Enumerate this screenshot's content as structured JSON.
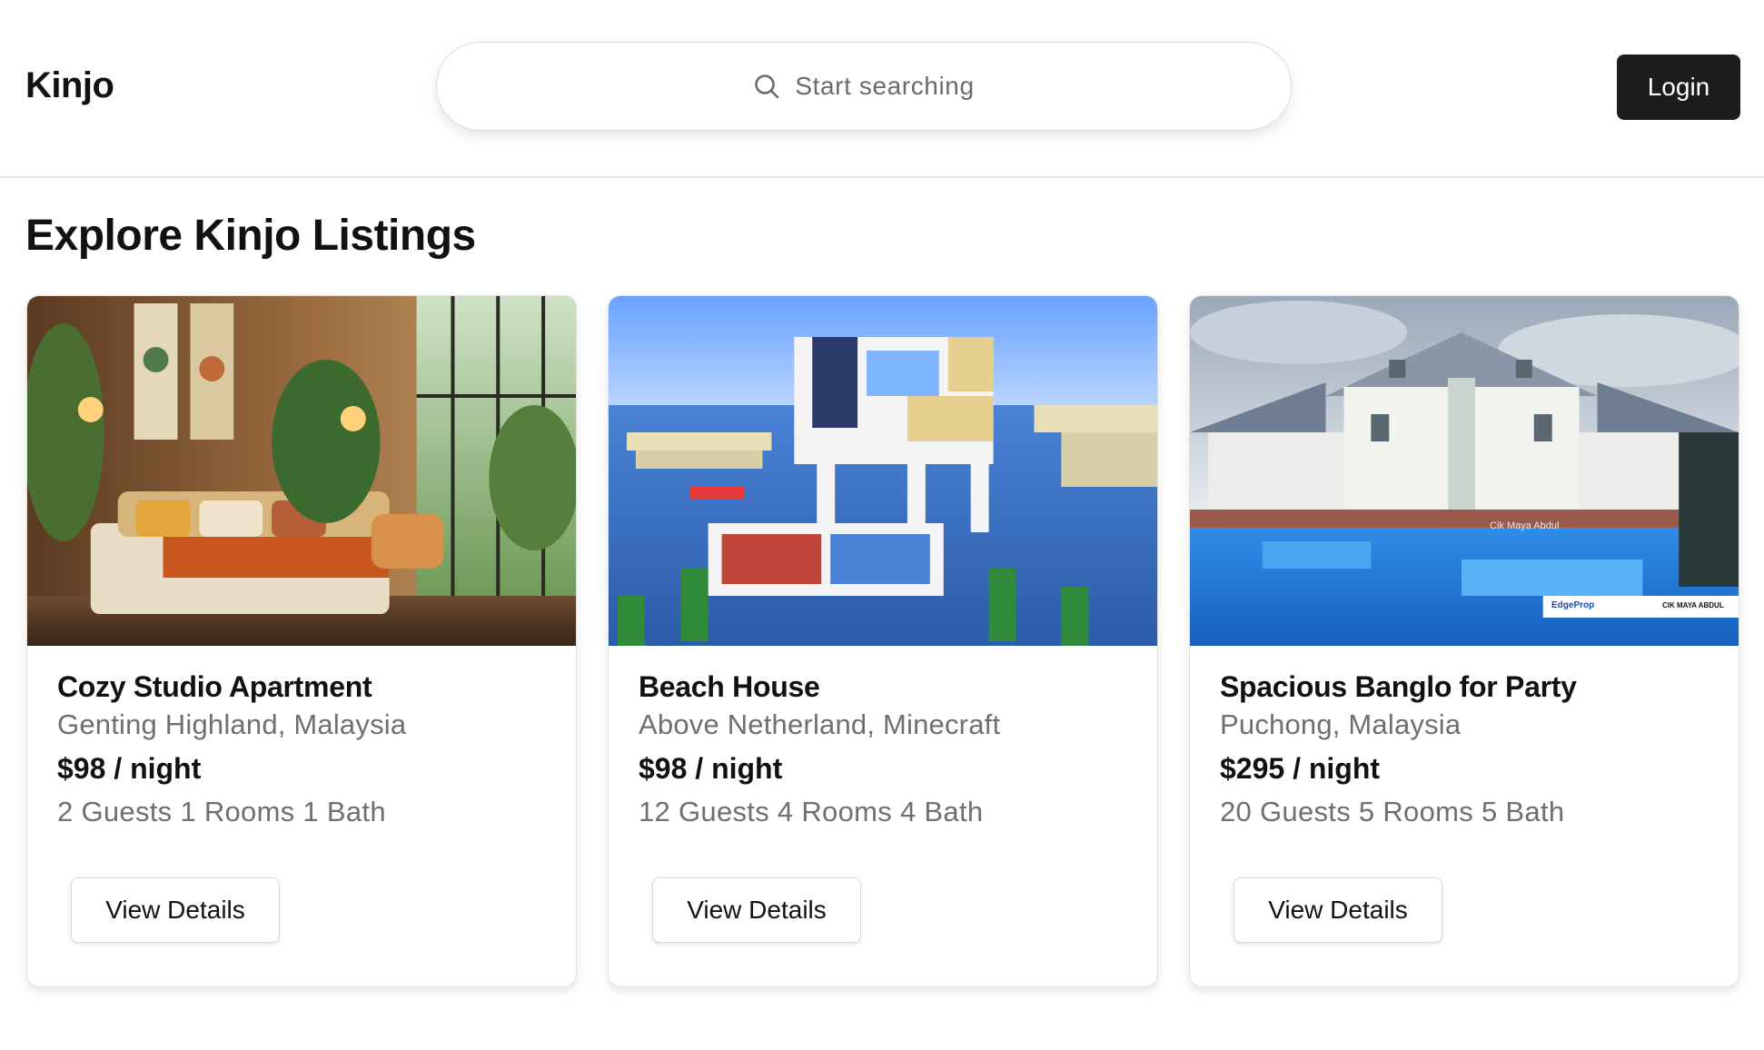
{
  "header": {
    "logo": "Kinjo",
    "search": {
      "placeholder": "Start searching",
      "icon": "search-icon"
    },
    "login_label": "Login"
  },
  "page": {
    "title": "Explore Kinjo Listings"
  },
  "listings": [
    {
      "title": "Cozy Studio Apartment",
      "location": "Genting Highland, Malaysia",
      "price": "$98 / night",
      "specs": "2 Guests 1 Rooms 1 Bath",
      "button": "View Details"
    },
    {
      "title": "Beach House",
      "location": "Above Netherland, Minecraft",
      "price": "$98 / night",
      "specs": "12 Guests 4 Rooms 4 Bath",
      "button": "View Details"
    },
    {
      "title": "Spacious Banglo for Party",
      "location": "Puchong, Malaysia",
      "price": "$295 / night",
      "specs": "20 Guests 5 Rooms 5 Bath",
      "button": "View Details",
      "photo_credit": "Cik Maya Abdul",
      "watermark_brand": "EdgeProp",
      "watermark_credit": "CIK MAYA ABDUL"
    }
  ],
  "colors": {
    "login_bg": "#1c1c1c",
    "text_primary": "#111111",
    "text_secondary": "#6f6f6f",
    "divider": "#e5e5e5"
  }
}
